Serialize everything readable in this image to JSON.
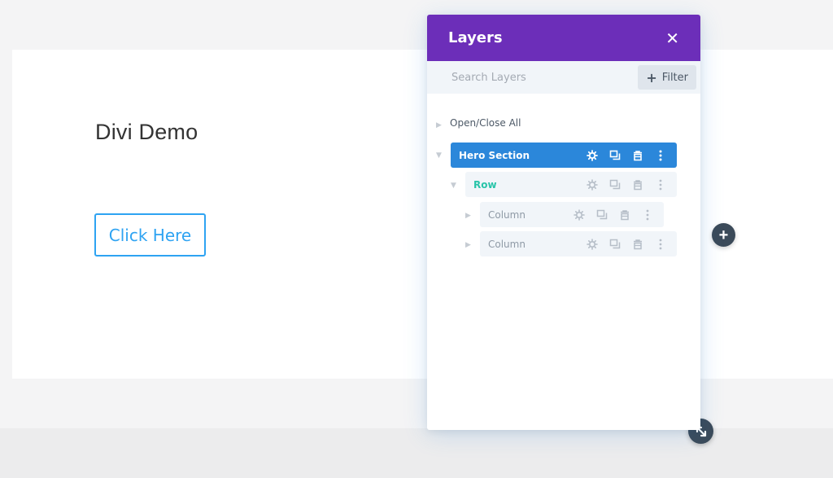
{
  "canvas": {
    "title": "Divi Demo",
    "button_label": "Click Here"
  },
  "layers_panel": {
    "title": "Layers",
    "close_label": "✕",
    "search": {
      "placeholder": "Search Layers",
      "value": ""
    },
    "filter_label": "Filter",
    "open_close_label": "Open/Close All",
    "items": [
      {
        "label": "Hero Section",
        "type": "section"
      },
      {
        "label": "Row",
        "type": "row"
      },
      {
        "label": "Column",
        "type": "column"
      },
      {
        "label": "Column",
        "type": "column"
      }
    ]
  },
  "colors": {
    "header_purple": "#6c2eb9",
    "section_blue": "#2b87da",
    "row_teal": "#29c4a9",
    "button_blue": "#2ea3f2",
    "dark_circle": "#3b4a59"
  },
  "icons": {
    "settings": "gear-icon",
    "duplicate": "duplicate-icon",
    "delete": "trash-icon",
    "more": "more-vertical-icon",
    "add": "plus-icon",
    "resize": "resize-icon"
  }
}
